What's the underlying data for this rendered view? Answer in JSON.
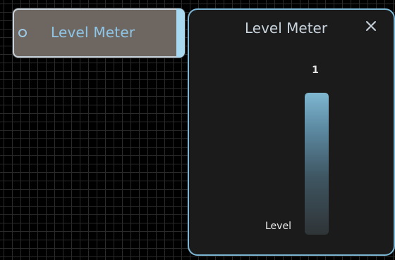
{
  "node": {
    "title": "Level Meter"
  },
  "panel": {
    "title": "Level Meter",
    "close_label": "✕",
    "meter": {
      "value_text": "1",
      "label": "Level",
      "fill_fraction": 1.0
    }
  },
  "colors": {
    "accent": "#7cb7d6",
    "node_title": "#8fc6e8",
    "panel_bg": "#1b1b1c",
    "node_bg": "#6e6761"
  }
}
